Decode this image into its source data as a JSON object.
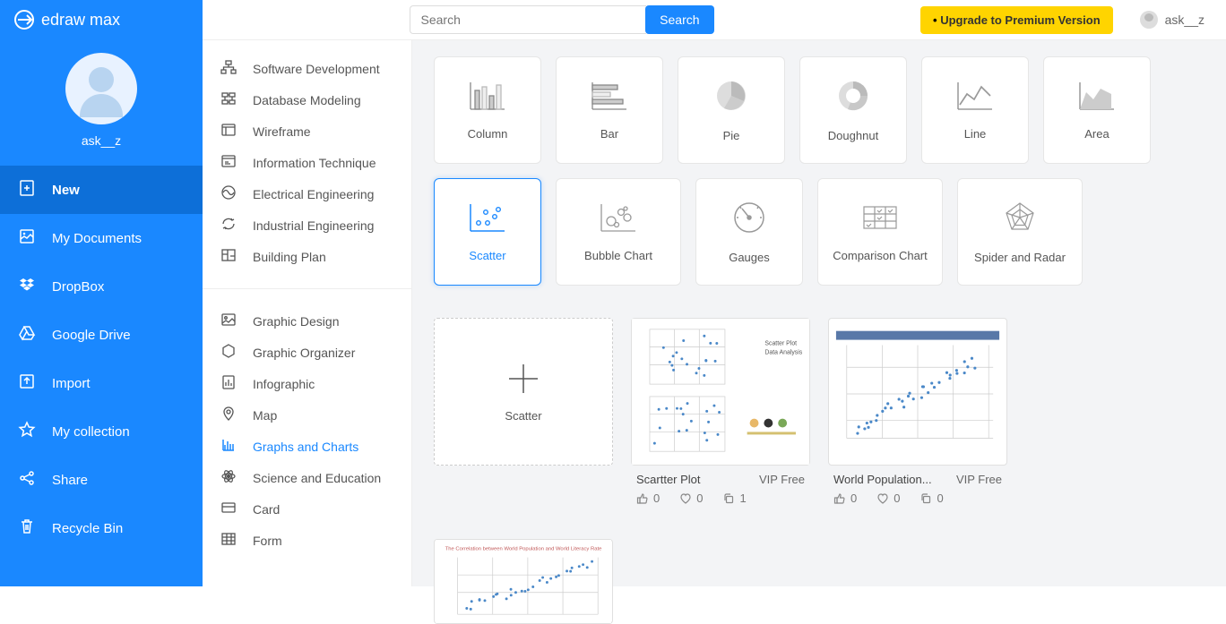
{
  "app": {
    "name": "edraw max"
  },
  "topbar": {
    "search_placeholder": "Search",
    "search_button": "Search",
    "upgrade": "Upgrade to Premium Version",
    "username": "ask__z"
  },
  "sidebar": {
    "username": "ask__z",
    "items": [
      {
        "label": "New",
        "icon": "plus-file-icon",
        "active": true
      },
      {
        "label": "My Documents",
        "icon": "documents-icon"
      },
      {
        "label": "DropBox",
        "icon": "dropbox-icon"
      },
      {
        "label": "Google Drive",
        "icon": "google-drive-icon"
      },
      {
        "label": "Import",
        "icon": "import-icon"
      },
      {
        "label": "My collection",
        "icon": "star-icon"
      },
      {
        "label": "Share",
        "icon": "share-icon"
      },
      {
        "label": "Recycle Bin",
        "icon": "trash-icon"
      }
    ]
  },
  "categories": {
    "group1": [
      {
        "label": "Software Development",
        "icon": "org-chart-icon"
      },
      {
        "label": "Database Modeling",
        "icon": "database-icon"
      },
      {
        "label": "Wireframe",
        "icon": "wireframe-icon"
      },
      {
        "label": "Information Technique",
        "icon": "window-icon"
      },
      {
        "label": "Electrical Engineering",
        "icon": "wave-icon"
      },
      {
        "label": "Industrial Engineering",
        "icon": "gear-cycle-icon"
      },
      {
        "label": "Building Plan",
        "icon": "blueprint-icon"
      }
    ],
    "group2": [
      {
        "label": "Graphic Design",
        "icon": "image-icon"
      },
      {
        "label": "Graphic Organizer",
        "icon": "hex-icon"
      },
      {
        "label": "Infographic",
        "icon": "doc-bar-icon"
      },
      {
        "label": "Map",
        "icon": "pin-icon"
      },
      {
        "label": "Graphs and Charts",
        "icon": "bar-chart-icon",
        "active": true
      },
      {
        "label": "Science and Education",
        "icon": "atom-icon"
      },
      {
        "label": "Card",
        "icon": "card-icon"
      },
      {
        "label": "Form",
        "icon": "table-icon"
      }
    ]
  },
  "chart_types": [
    {
      "label": "Column",
      "icon": "column"
    },
    {
      "label": "Bar",
      "icon": "bar"
    },
    {
      "label": "Pie",
      "icon": "pie"
    },
    {
      "label": "Doughnut",
      "icon": "doughnut"
    },
    {
      "label": "Line",
      "icon": "line"
    },
    {
      "label": "Area",
      "icon": "area"
    },
    {
      "label": "Scatter",
      "icon": "scatter",
      "active": true
    },
    {
      "label": "Bubble Chart",
      "icon": "bubble"
    },
    {
      "label": "Gauges",
      "icon": "gauge"
    },
    {
      "label": "Comparison Chart",
      "icon": "compare"
    },
    {
      "label": "Spider and Radar",
      "icon": "radar"
    }
  ],
  "templates": {
    "new_label": "Scatter",
    "items": [
      {
        "title": "Scartter Plot",
        "vip": "VIP Free",
        "likes": 0,
        "favs": 0,
        "copies": 1
      },
      {
        "title": "World Population...",
        "vip": "VIP Free",
        "likes": 0,
        "favs": 0,
        "copies": 0
      }
    ]
  }
}
